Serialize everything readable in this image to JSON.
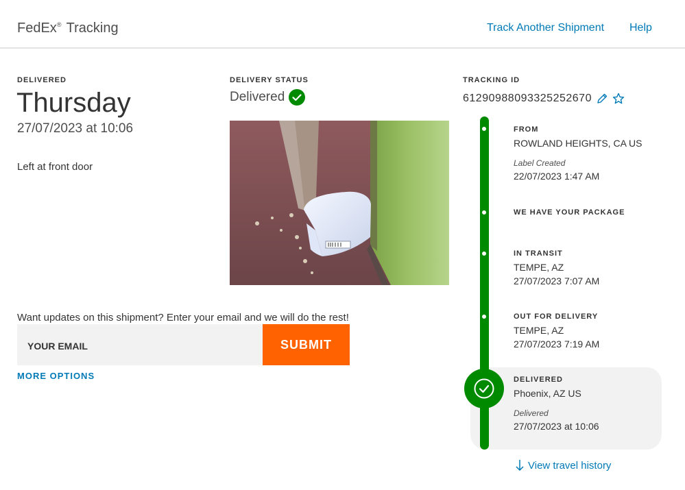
{
  "header": {
    "brand_name": "FedEx",
    "brand_mark": "®",
    "brand_suffix": "Tracking",
    "nav": {
      "track_another": "Track Another Shipment",
      "help": "Help"
    }
  },
  "delivered": {
    "label": "DELIVERED",
    "day": "Thursday",
    "datetime": "27/07/2023 at 10:06",
    "note": "Left at front door"
  },
  "delivery_status": {
    "label": "DELIVERY STATUS",
    "value": "Delivered",
    "icon": "check-circle-icon",
    "photo_icon": "package-photo"
  },
  "email": {
    "prompt": "Want updates on this shipment? Enter your email and we will do the rest!",
    "placeholder": "YOUR EMAIL",
    "submit_label": "SUBMIT",
    "more_options": "MORE OPTIONS"
  },
  "tracking": {
    "label": "TRACKING ID",
    "number": "61290988093325252670",
    "edit_icon": "pencil-icon",
    "favorite_icon": "star-icon"
  },
  "timeline": [
    {
      "title": "FROM",
      "line1": "ROWLAND HEIGHTS, CA US",
      "italic": "Label Created",
      "line2": "22/07/2023 1:47 AM"
    },
    {
      "title": "WE HAVE YOUR PACKAGE"
    },
    {
      "title": "IN TRANSIT",
      "line1": "TEMPE, AZ",
      "line2": "27/07/2023 7:07 AM"
    },
    {
      "title": "OUT FOR DELIVERY",
      "line1": "TEMPE, AZ",
      "line2": "27/07/2023 7:19 AM"
    },
    {
      "title": "DELIVERED",
      "line1": "Phoenix, AZ US",
      "italic": "Delivered",
      "line2": "27/07/2023 at 10:06"
    }
  ],
  "view_history": {
    "label": "View travel history",
    "icon": "arrow-down-icon"
  },
  "colors": {
    "brand_link": "#007ab7",
    "submit_orange": "#ff6200",
    "status_green": "#008a00",
    "panel_gray": "#f2f2f2"
  }
}
